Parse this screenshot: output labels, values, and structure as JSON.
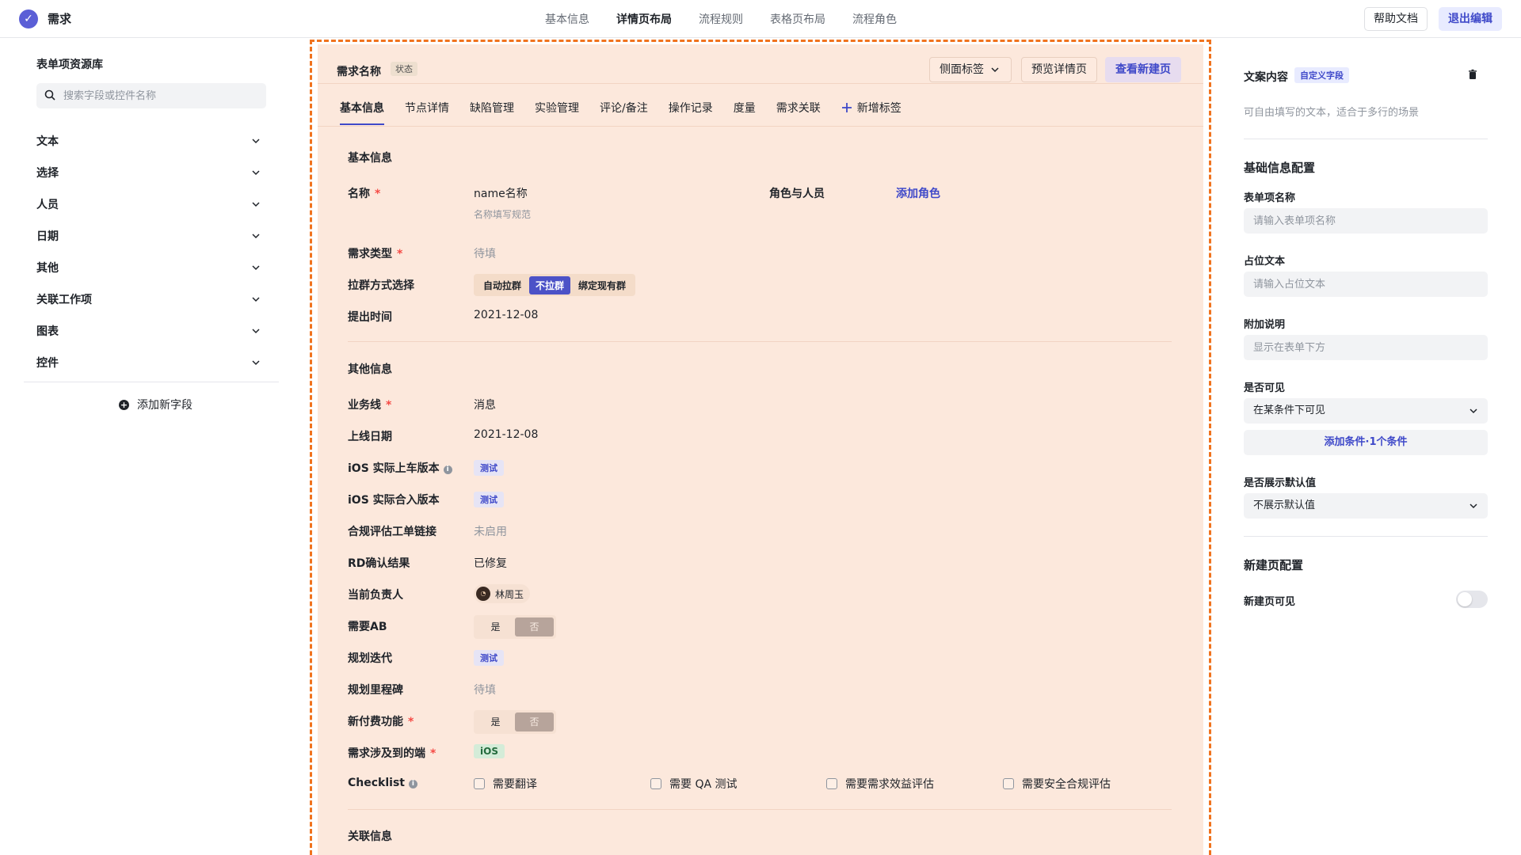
{
  "header": {
    "app_title": "需求",
    "nav": [
      "基本信息",
      "详情页布局",
      "流程规则",
      "表格页布局",
      "流程角色"
    ],
    "active_nav": "详情页布局",
    "help_label": "帮助文档",
    "exit_label": "退出编辑"
  },
  "left": {
    "title": "表单项资源库",
    "search_placeholder": "搜索字段或控件名称",
    "categories": [
      "文本",
      "选择",
      "人员",
      "日期",
      "其他",
      "关联工作项",
      "图表",
      "控件"
    ],
    "add_field_label": "添加新字段"
  },
  "canvas": {
    "req_name": "需求名称",
    "status": "状态",
    "side_tab_label": "侧面标签",
    "preview_label": "预览详情页",
    "view_new_label": "查看新建页",
    "tabs": [
      "基本信息",
      "节点详情",
      "缺陷管理",
      "实验管理",
      "评论/备注",
      "操作记录",
      "度量",
      "需求关联"
    ],
    "add_tab_label": "新增标签",
    "basic": {
      "title": "基本信息",
      "name_label": "名称",
      "name_value": "name名称",
      "name_hint": "名称填写规范",
      "roles_label": "角色与人员",
      "add_role_label": "添加角色",
      "type_label": "需求类型",
      "type_value": "待填",
      "group_label": "拉群方式选择",
      "group_options": [
        "自动拉群",
        "不拉群",
        "绑定现有群"
      ],
      "time_label": "提出时间",
      "time_value": "2021-12-08"
    },
    "other": {
      "title": "其他信息",
      "business_label": "业务线",
      "business_value": "消息",
      "online_label": "上线日期",
      "online_value": "2021-12-08",
      "ios_ver_label": "iOS 实际上车版本",
      "ios_ver_value": "测试",
      "ios_merge_label": "iOS 实际合入版本",
      "ios_merge_value": "测试",
      "compliance_label": "合规评估工单链接",
      "compliance_value": "未启用",
      "rd_label": "RD确认结果",
      "rd_value": "已修复",
      "owner_label": "当前负责人",
      "owner_value": "林周玉",
      "ab_label": "需要AB",
      "yes": "是",
      "no": "否",
      "iter_label": "规划迭代",
      "iter_value": "测试",
      "milestone_label": "规划里程碑",
      "milestone_value": "待填",
      "paid_label": "新付费功能",
      "platform_label": "需求涉及到的端",
      "platform_value": "iOS",
      "checklist_label": "Checklist",
      "checklist_items": [
        "需要翻译",
        "需要 QA 测试",
        "需要需求效益评估",
        "需要安全合规评估"
      ]
    },
    "related_title": "关联信息"
  },
  "right": {
    "title": "文案内容",
    "badge": "自定义字段",
    "desc": "可自由填写的文本，适合于多行的场景",
    "basic_config": "基础信息配置",
    "field_name_label": "表单项名称",
    "field_name_placeholder": "请输入表单项名称",
    "placeholder_label": "占位文本",
    "placeholder_placeholder": "请输入占位文本",
    "extra_label": "附加说明",
    "extra_placeholder": "显示在表单下方",
    "visible_label": "是否可见",
    "visible_value": "在某条件下可见",
    "add_condition": "添加条件·1个条件",
    "default_label": "是否展示默认值",
    "default_value": "不展示默认值",
    "new_page_config": "新建页配置",
    "new_page_visible_label": "新建页可见",
    "new_page_visible": false
  },
  "colors": {
    "accent": "#3f49c9",
    "canvas_bg": "#fce8dc",
    "dashed_border": "#f0731e",
    "required": "#f54a45"
  }
}
